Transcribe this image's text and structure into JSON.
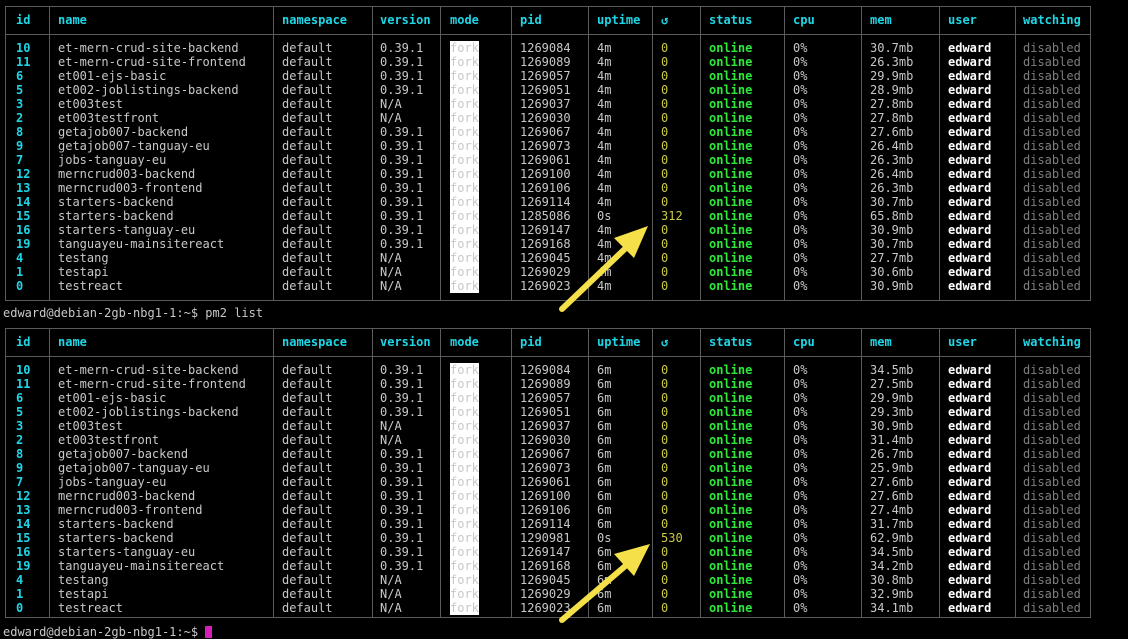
{
  "columns": [
    "id",
    "name",
    "namespace",
    "version",
    "mode",
    "pid",
    "uptime",
    "↺",
    "status",
    "cpu",
    "mem",
    "user",
    "watching"
  ],
  "tables": [
    {
      "rows": [
        [
          "10",
          "et-mern-crud-site-backend",
          "default",
          "0.39.1",
          "fork",
          "1269084",
          "4m",
          "0",
          "online",
          "0%",
          "30.7mb",
          "edward",
          "disabled"
        ],
        [
          "11",
          "et-mern-crud-site-frontend",
          "default",
          "0.39.1",
          "fork",
          "1269089",
          "4m",
          "0",
          "online",
          "0%",
          "26.3mb",
          "edward",
          "disabled"
        ],
        [
          "6",
          "et001-ejs-basic",
          "default",
          "0.39.1",
          "fork",
          "1269057",
          "4m",
          "0",
          "online",
          "0%",
          "29.9mb",
          "edward",
          "disabled"
        ],
        [
          "5",
          "et002-joblistings-backend",
          "default",
          "0.39.1",
          "fork",
          "1269051",
          "4m",
          "0",
          "online",
          "0%",
          "28.9mb",
          "edward",
          "disabled"
        ],
        [
          "3",
          "et003test",
          "default",
          "N/A",
          "fork",
          "1269037",
          "4m",
          "0",
          "online",
          "0%",
          "27.8mb",
          "edward",
          "disabled"
        ],
        [
          "2",
          "et003testfront",
          "default",
          "N/A",
          "fork",
          "1269030",
          "4m",
          "0",
          "online",
          "0%",
          "27.8mb",
          "edward",
          "disabled"
        ],
        [
          "8",
          "getajob007-backend",
          "default",
          "0.39.1",
          "fork",
          "1269067",
          "4m",
          "0",
          "online",
          "0%",
          "27.6mb",
          "edward",
          "disabled"
        ],
        [
          "9",
          "getajob007-tanguay-eu",
          "default",
          "0.39.1",
          "fork",
          "1269073",
          "4m",
          "0",
          "online",
          "0%",
          "26.4mb",
          "edward",
          "disabled"
        ],
        [
          "7",
          "jobs-tanguay-eu",
          "default",
          "0.39.1",
          "fork",
          "1269061",
          "4m",
          "0",
          "online",
          "0%",
          "26.3mb",
          "edward",
          "disabled"
        ],
        [
          "12",
          "merncrud003-backend",
          "default",
          "0.39.1",
          "fork",
          "1269100",
          "4m",
          "0",
          "online",
          "0%",
          "26.4mb",
          "edward",
          "disabled"
        ],
        [
          "13",
          "merncrud003-frontend",
          "default",
          "0.39.1",
          "fork",
          "1269106",
          "4m",
          "0",
          "online",
          "0%",
          "26.3mb",
          "edward",
          "disabled"
        ],
        [
          "14",
          "starters-backend",
          "default",
          "0.39.1",
          "fork",
          "1269114",
          "4m",
          "0",
          "online",
          "0%",
          "30.7mb",
          "edward",
          "disabled"
        ],
        [
          "15",
          "starters-backend",
          "default",
          "0.39.1",
          "fork",
          "1285086",
          "0s",
          "312",
          "online",
          "0%",
          "65.8mb",
          "edward",
          "disabled"
        ],
        [
          "16",
          "starters-tanguay-eu",
          "default",
          "0.39.1",
          "fork",
          "1269147",
          "4m",
          "0",
          "online",
          "0%",
          "30.9mb",
          "edward",
          "disabled"
        ],
        [
          "19",
          "tanguayeu-mainsitereact",
          "default",
          "0.39.1",
          "fork",
          "1269168",
          "4m",
          "0",
          "online",
          "0%",
          "30.7mb",
          "edward",
          "disabled"
        ],
        [
          "4",
          "testang",
          "default",
          "N/A",
          "fork",
          "1269045",
          "4m",
          "0",
          "online",
          "0%",
          "27.7mb",
          "edward",
          "disabled"
        ],
        [
          "1",
          "testapi",
          "default",
          "N/A",
          "fork",
          "1269029",
          "4m",
          "0",
          "online",
          "0%",
          "30.6mb",
          "edward",
          "disabled"
        ],
        [
          "0",
          "testreact",
          "default",
          "N/A",
          "fork",
          "1269023",
          "4m",
          "0",
          "online",
          "0%",
          "30.9mb",
          "edward",
          "disabled"
        ]
      ]
    },
    {
      "rows": [
        [
          "10",
          "et-mern-crud-site-backend",
          "default",
          "0.39.1",
          "fork",
          "1269084",
          "6m",
          "0",
          "online",
          "0%",
          "34.5mb",
          "edward",
          "disabled"
        ],
        [
          "11",
          "et-mern-crud-site-frontend",
          "default",
          "0.39.1",
          "fork",
          "1269089",
          "6m",
          "0",
          "online",
          "0%",
          "27.5mb",
          "edward",
          "disabled"
        ],
        [
          "6",
          "et001-ejs-basic",
          "default",
          "0.39.1",
          "fork",
          "1269057",
          "6m",
          "0",
          "online",
          "0%",
          "29.9mb",
          "edward",
          "disabled"
        ],
        [
          "5",
          "et002-joblistings-backend",
          "default",
          "0.39.1",
          "fork",
          "1269051",
          "6m",
          "0",
          "online",
          "0%",
          "29.3mb",
          "edward",
          "disabled"
        ],
        [
          "3",
          "et003test",
          "default",
          "N/A",
          "fork",
          "1269037",
          "6m",
          "0",
          "online",
          "0%",
          "30.9mb",
          "edward",
          "disabled"
        ],
        [
          "2",
          "et003testfront",
          "default",
          "N/A",
          "fork",
          "1269030",
          "6m",
          "0",
          "online",
          "0%",
          "31.4mb",
          "edward",
          "disabled"
        ],
        [
          "8",
          "getajob007-backend",
          "default",
          "0.39.1",
          "fork",
          "1269067",
          "6m",
          "0",
          "online",
          "0%",
          "26.7mb",
          "edward",
          "disabled"
        ],
        [
          "9",
          "getajob007-tanguay-eu",
          "default",
          "0.39.1",
          "fork",
          "1269073",
          "6m",
          "0",
          "online",
          "0%",
          "25.9mb",
          "edward",
          "disabled"
        ],
        [
          "7",
          "jobs-tanguay-eu",
          "default",
          "0.39.1",
          "fork",
          "1269061",
          "6m",
          "0",
          "online",
          "0%",
          "27.6mb",
          "edward",
          "disabled"
        ],
        [
          "12",
          "merncrud003-backend",
          "default",
          "0.39.1",
          "fork",
          "1269100",
          "6m",
          "0",
          "online",
          "0%",
          "27.6mb",
          "edward",
          "disabled"
        ],
        [
          "13",
          "merncrud003-frontend",
          "default",
          "0.39.1",
          "fork",
          "1269106",
          "6m",
          "0",
          "online",
          "0%",
          "27.4mb",
          "edward",
          "disabled"
        ],
        [
          "14",
          "starters-backend",
          "default",
          "0.39.1",
          "fork",
          "1269114",
          "6m",
          "0",
          "online",
          "0%",
          "31.7mb",
          "edward",
          "disabled"
        ],
        [
          "15",
          "starters-backend",
          "default",
          "0.39.1",
          "fork",
          "1290981",
          "0s",
          "530",
          "online",
          "0%",
          "62.9mb",
          "edward",
          "disabled"
        ],
        [
          "16",
          "starters-tanguay-eu",
          "default",
          "0.39.1",
          "fork",
          "1269147",
          "6m",
          "0",
          "online",
          "0%",
          "34.5mb",
          "edward",
          "disabled"
        ],
        [
          "19",
          "tanguayeu-mainsitereact",
          "default",
          "0.39.1",
          "fork",
          "1269168",
          "6m",
          "0",
          "online",
          "0%",
          "34.2mb",
          "edward",
          "disabled"
        ],
        [
          "4",
          "testang",
          "default",
          "N/A",
          "fork",
          "1269045",
          "6m",
          "0",
          "online",
          "0%",
          "30.8mb",
          "edward",
          "disabled"
        ],
        [
          "1",
          "testapi",
          "default",
          "N/A",
          "fork",
          "1269029",
          "6m",
          "0",
          "online",
          "0%",
          "32.9mb",
          "edward",
          "disabled"
        ],
        [
          "0",
          "testreact",
          "default",
          "N/A",
          "fork",
          "1269023",
          "6m",
          "0",
          "online",
          "0%",
          "34.1mb",
          "edward",
          "disabled"
        ]
      ]
    }
  ],
  "prompt_line": "edward@debian-2gb-nbg1-1:~$ pm2 list",
  "bottom_prompt": "edward@debian-2gb-nbg1-1:~$ ",
  "colors": {
    "header": "#1fd6e6",
    "status_online": "#2fe83a",
    "restart_count": "#c9c943",
    "arrow": "#f5e04a",
    "cursor": "#d61fb8"
  },
  "icons": [
    "arrow-annotation-icon"
  ]
}
